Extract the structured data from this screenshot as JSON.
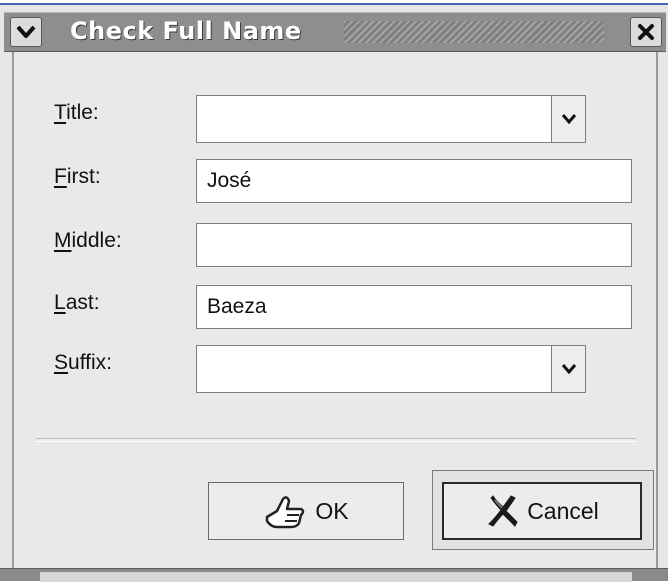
{
  "window": {
    "title": "Check Full Name"
  },
  "form": {
    "title_label_u": "T",
    "title_label_rest": "itle:",
    "title_value": "",
    "first_label_u": "F",
    "first_label_rest": "irst:",
    "first_value": "José",
    "middle_label_u": "M",
    "middle_label_rest": "iddle:",
    "middle_value": "",
    "last_label_u": "L",
    "last_label_rest": "ast:",
    "last_value": "Baeza",
    "suffix_label_u": "S",
    "suffix_label_rest": "uffix:",
    "suffix_value": ""
  },
  "buttons": {
    "ok_label": "OK",
    "cancel_label": "Cancel"
  },
  "icons": {
    "window_menu": "chevron-down-icon",
    "window_close": "close-icon",
    "combo_arrow": "chevron-down-icon",
    "ok": "ok-hand-icon",
    "cancel": "cancel-x-icon"
  }
}
